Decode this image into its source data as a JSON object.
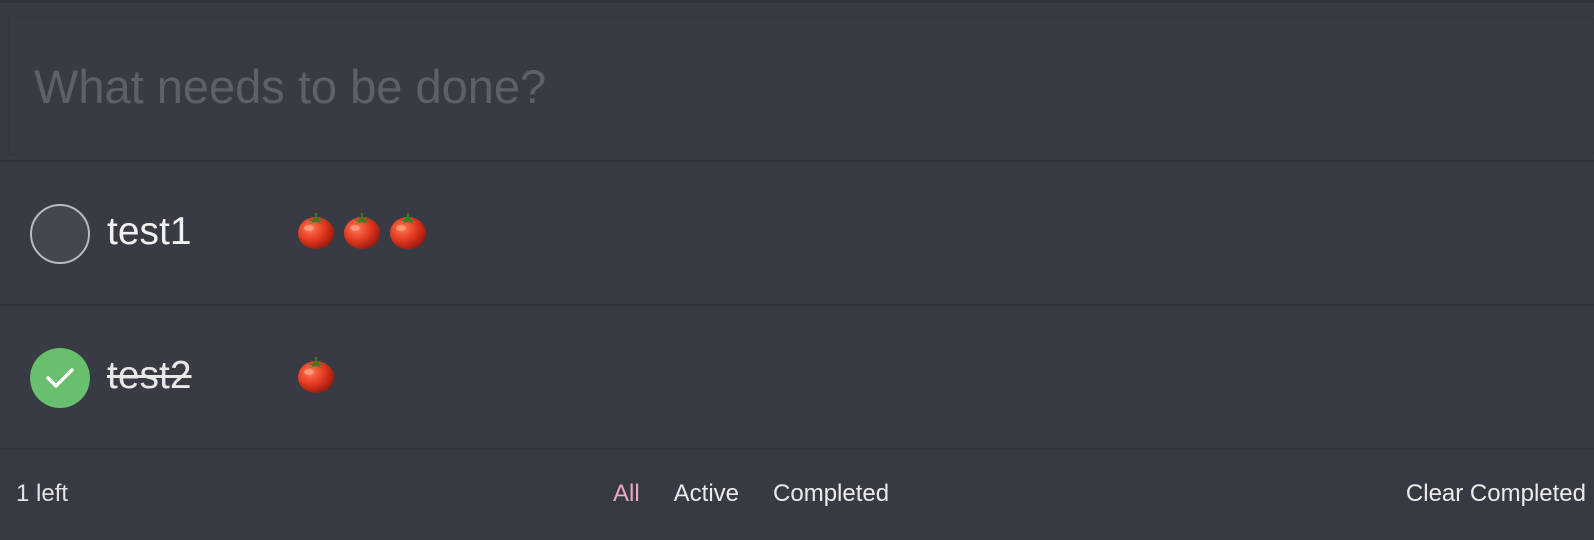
{
  "new_todo": {
    "placeholder": "What needs to be done?",
    "value": ""
  },
  "todos": [
    {
      "label": "test1",
      "completed": false,
      "pomodoros": 3
    },
    {
      "label": "test2",
      "completed": true,
      "pomodoros": 1
    }
  ],
  "footer": {
    "count_text": "1 left",
    "filters": [
      "All",
      "Active",
      "Completed"
    ],
    "selected_filter": "All",
    "clear_label": "Clear Completed"
  },
  "colors": {
    "background": "#383b44",
    "completed_green": "#68bf6e",
    "selected_filter": "#f0a6c6"
  },
  "icons": {
    "pomodoro": "tomato-icon",
    "check": "checkmark-icon"
  }
}
